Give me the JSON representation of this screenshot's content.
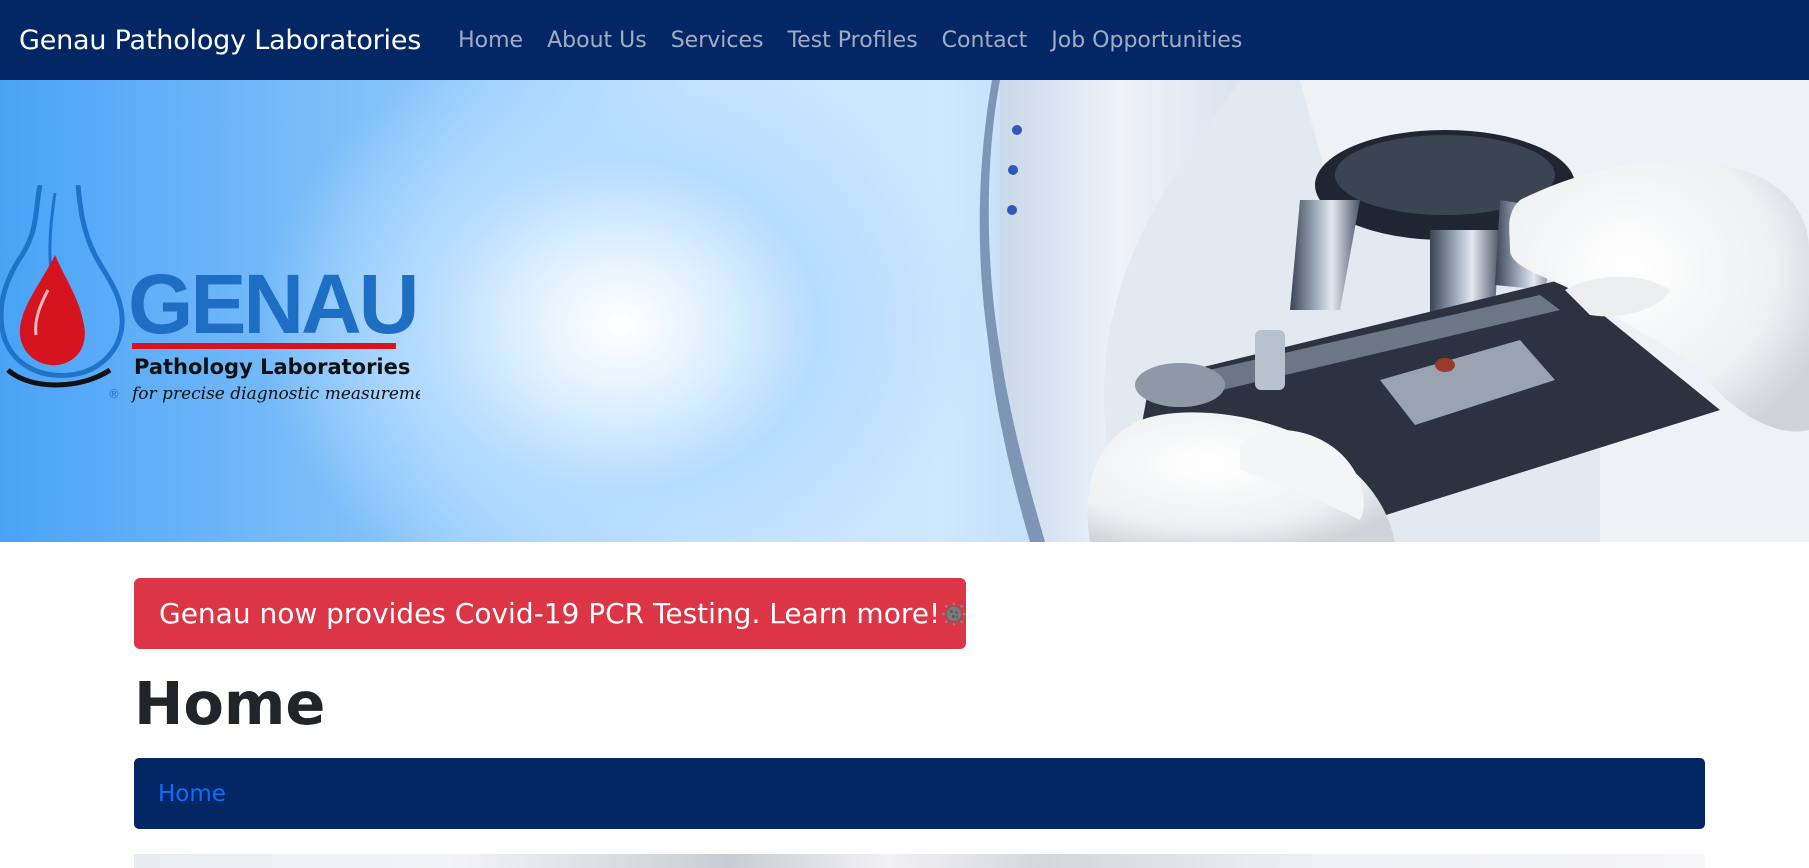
{
  "navbar": {
    "brand": "Genau Pathology Laboratories",
    "links": [
      "Home",
      "About Us",
      "Services",
      "Test Profiles",
      "Contact",
      "Job Opportunities"
    ],
    "background": "#032764"
  },
  "hero": {
    "logo": {
      "name": "GENAU",
      "line1": "Pathology Laboratories",
      "tagline": "for precise diagnostic measurement",
      "registered": "®"
    }
  },
  "alert": {
    "text": "Genau now provides Covid-19 PCR Testing. Learn more!",
    "icon": "virus-icon",
    "color": "#dc3545"
  },
  "page_title": "Home",
  "breadcrumb": {
    "items": [
      "Home"
    ],
    "link_color": "#0d6efd"
  }
}
